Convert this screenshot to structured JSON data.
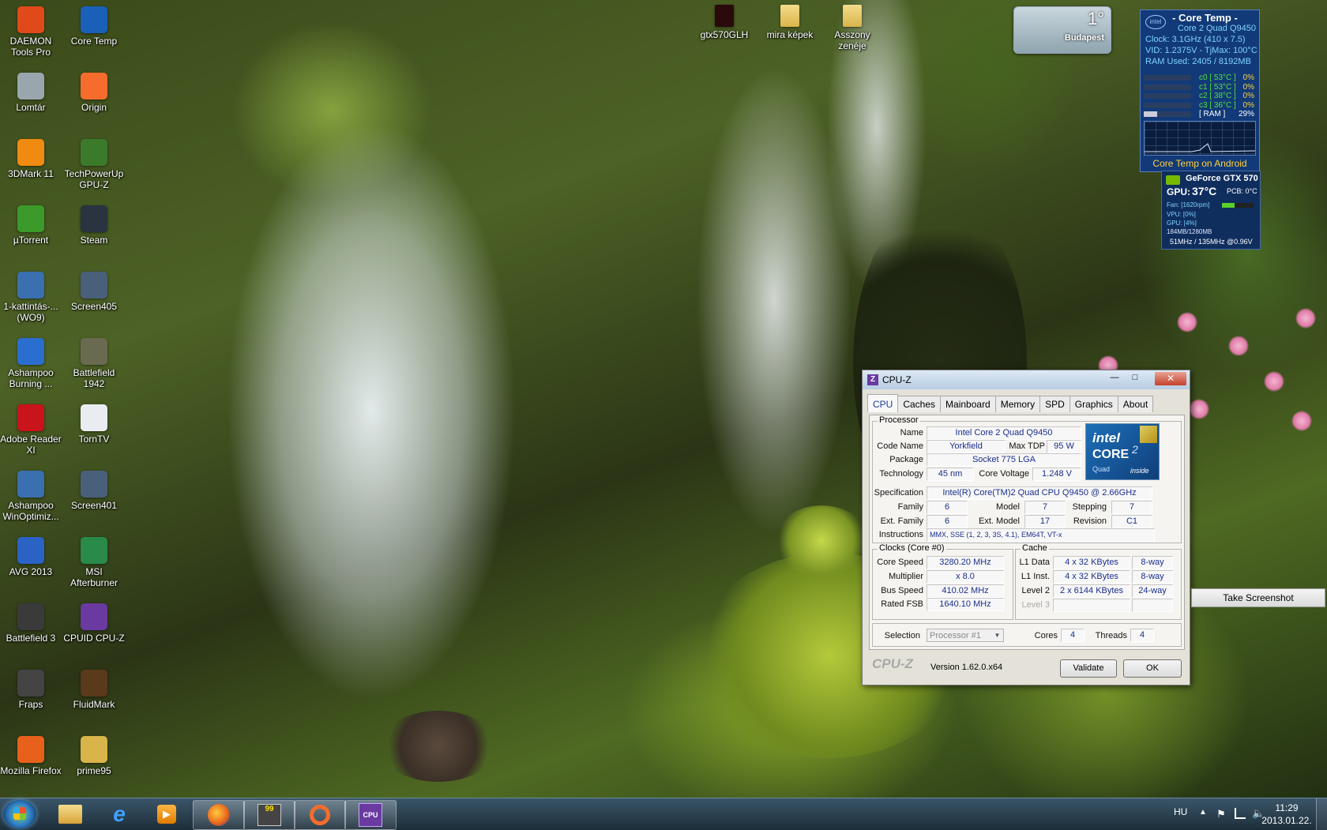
{
  "desktop_icons": [
    {
      "label": "DAEMON Tools Pro",
      "icon": "daemon-tools-icon"
    },
    {
      "label": "Core Temp",
      "icon": "core-temp-icon"
    },
    {
      "label": "Lomtár",
      "icon": "recycle-bin-icon"
    },
    {
      "label": "Origin",
      "icon": "origin-icon"
    },
    {
      "label": "3DMark 11",
      "icon": "3dmark-icon"
    },
    {
      "label": "TechPowerUp GPU-Z",
      "icon": "gpu-z-icon"
    },
    {
      "label": "µTorrent",
      "icon": "utorrent-icon"
    },
    {
      "label": "Steam",
      "icon": "steam-icon"
    },
    {
      "label": "1-kattintás-... (WO9)",
      "icon": "one-click-icon"
    },
    {
      "label": "Screen405",
      "icon": "screen-icon"
    },
    {
      "label": "Ashampoo Burning ...",
      "icon": "ashampoo-burning-icon"
    },
    {
      "label": "Battlefield 1942",
      "icon": "battlefield-1942-icon"
    },
    {
      "label": "Adobe Reader XI",
      "icon": "adobe-reader-icon"
    },
    {
      "label": "TornTV",
      "icon": "torntv-icon"
    },
    {
      "label": "Ashampoo WinOptimiz...",
      "icon": "ashampoo-winoptimizer-icon"
    },
    {
      "label": "Screen401",
      "icon": "screen-icon"
    },
    {
      "label": "AVG 2013",
      "icon": "avg-icon"
    },
    {
      "label": "MSI Afterburner",
      "icon": "msi-afterburner-icon"
    },
    {
      "label": "Battlefield 3",
      "icon": "battlefield-3-icon"
    },
    {
      "label": "CPUID CPU-Z",
      "icon": "cpuz-icon"
    },
    {
      "label": "Fraps",
      "icon": "fraps-icon"
    },
    {
      "label": "FluidMark",
      "icon": "fluidmark-icon"
    },
    {
      "label": "Mozilla Firefox",
      "icon": "firefox-icon"
    },
    {
      "label": "prime95",
      "icon": "folder-icon"
    }
  ],
  "top_icons": [
    {
      "label": "gtx570GLH",
      "icon": "gtx-file-icon"
    },
    {
      "label": "mira képek",
      "icon": "folder-icon"
    },
    {
      "label": "Asszony zenéje",
      "icon": "folder-icon"
    }
  ],
  "weather": {
    "temp": "1°",
    "city": "Budapest"
  },
  "coretemp": {
    "title": "- Core Temp -",
    "cpu": "Core 2 Quad Q9450",
    "clock": "Clock: 3.1GHz (410 x 7.5)",
    "vid": "VID: 1.2375V - TjMax: 100°C",
    "ram": "RAM Used: 2405 / 8192MB",
    "cores": [
      {
        "label": "c0 [ 53°C ]",
        "load": "0%"
      },
      {
        "label": "c1 [ 53°C ]",
        "load": "0%"
      },
      {
        "label": "c2 [ 38°C ]",
        "load": "0%"
      },
      {
        "label": "c3 [ 36°C ]",
        "load": "0%"
      }
    ],
    "ram_row": {
      "label": "[ RAM ]",
      "load": "29%",
      "fraction": 0.29
    },
    "footer": "Core Temp on Android"
  },
  "gpu": {
    "name": "GeForce GTX 570",
    "gpu_temp_label": "GPU:",
    "gpu_temp": "37°C",
    "pcb": "PCB: 0°C",
    "fan": "Fan: [1620rpm]",
    "vpu": "VPU: [0%]",
    "gpu_load": "GPU: [4%]",
    "mem": "184MB/1280MB",
    "clocks": "51MHz / 135MHz @0.96V"
  },
  "cpuz": {
    "title": "CPU-Z",
    "tabs": [
      "CPU",
      "Caches",
      "Mainboard",
      "Memory",
      "SPD",
      "Graphics",
      "About"
    ],
    "processor": {
      "group": "Processor",
      "name_label": "Name",
      "name": "Intel Core 2 Quad Q9450",
      "codename_label": "Code Name",
      "codename": "Yorkfield",
      "maxtdp_label": "Max TDP",
      "maxtdp": "95 W",
      "package_label": "Package",
      "package": "Socket 775 LGA",
      "technology_label": "Technology",
      "technology": "45 nm",
      "corevoltage_label": "Core Voltage",
      "corevoltage": "1.248 V",
      "spec_label": "Specification",
      "spec": "Intel(R) Core(TM)2 Quad  CPU   Q9450  @ 2.66GHz",
      "family_label": "Family",
      "family": "6",
      "model_label": "Model",
      "model": "7",
      "stepping_label": "Stepping",
      "stepping": "7",
      "extfamily_label": "Ext. Family",
      "extfamily": "6",
      "extmodel_label": "Ext. Model",
      "extmodel": "17",
      "revision_label": "Revision",
      "revision": "C1",
      "instructions_label": "Instructions",
      "instructions": "MMX, SSE (1, 2, 3, 3S, 4.1), EM64T, VT-x"
    },
    "logo": {
      "brand": "intel",
      "line1": "CORE",
      "sup": "2",
      "line2": "Quad",
      "line3": "inside"
    },
    "clocks": {
      "group": "Clocks (Core #0)",
      "corespeed_label": "Core Speed",
      "corespeed": "3280.20 MHz",
      "multiplier_label": "Multiplier",
      "multiplier": "x 8.0",
      "busspeed_label": "Bus Speed",
      "busspeed": "410.02 MHz",
      "ratedfsb_label": "Rated FSB",
      "ratedfsb": "1640.10 MHz"
    },
    "cache": {
      "group": "Cache",
      "rows": [
        {
          "label": "L1 Data",
          "size": "4 x 32 KBytes",
          "way": "8-way"
        },
        {
          "label": "L1 Inst.",
          "size": "4 x 32 KBytes",
          "way": "8-way"
        },
        {
          "label": "Level 2",
          "size": "2 x 6144 KBytes",
          "way": "24-way"
        },
        {
          "label": "Level 3",
          "size": "",
          "way": ""
        }
      ]
    },
    "selection_label": "Selection",
    "selection": "Processor #1",
    "cores_label": "Cores",
    "cores": "4",
    "threads_label": "Threads",
    "threads": "4",
    "brand": "CPU-Z",
    "version": "Version 1.62.0.x64",
    "validate": "Validate",
    "ok": "OK"
  },
  "take_screenshot": "Take Screenshot",
  "taskbar": {
    "lang": "HU",
    "time": "11:29",
    "date": "2013.01.22.",
    "items": [
      "start-orb-icon",
      "explorer-icon",
      "internet-explorer-icon",
      "media-player-icon",
      "firefox-icon",
      "fraps-icon",
      "origin-icon",
      "cpuz-icon"
    ]
  }
}
